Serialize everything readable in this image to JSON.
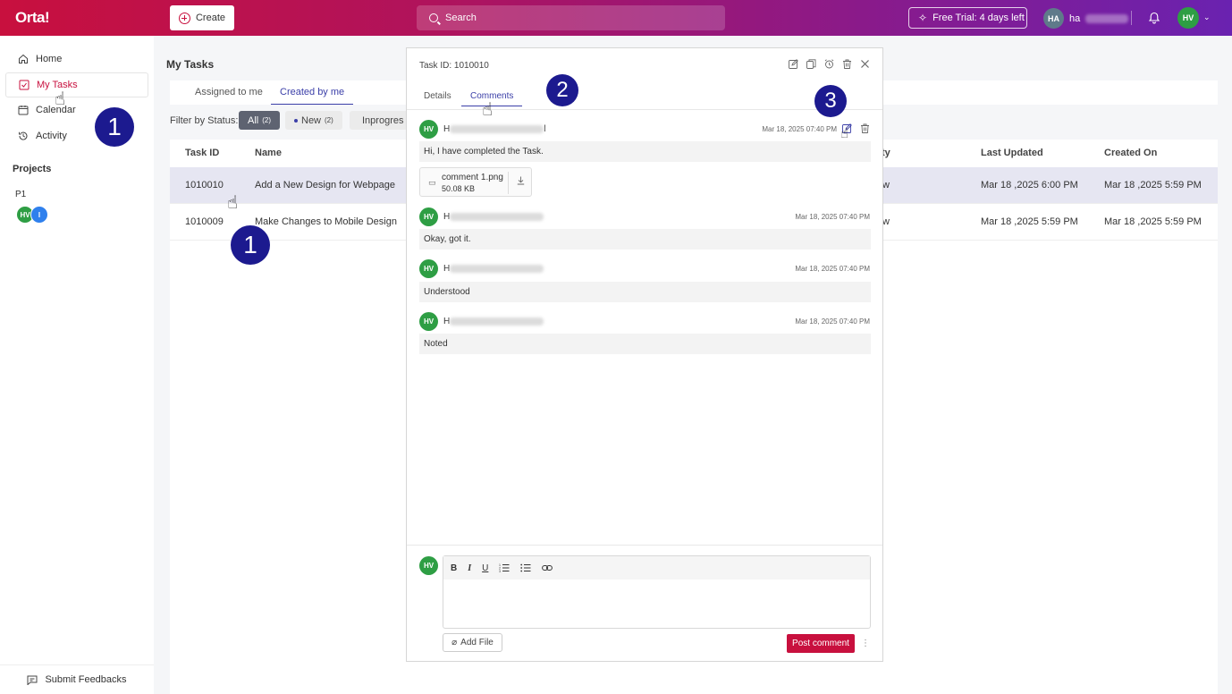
{
  "topbar": {
    "logo": "Orta!",
    "create_label": "Create",
    "search_placeholder": "Search",
    "trial_label": "Free Trial: 4 days left",
    "user_initials": "HA",
    "user_name_visible": "ha",
    "profile_initials": "HV"
  },
  "sidebar": {
    "items": [
      {
        "label": "Home",
        "icon": "home-icon"
      },
      {
        "label": "My Tasks",
        "icon": "checkbox-icon"
      },
      {
        "label": "Calendar",
        "icon": "calendar-icon"
      },
      {
        "label": "Activity",
        "icon": "history-icon"
      }
    ],
    "projects_title": "Projects",
    "project_name": "P1",
    "project_members": [
      "HV",
      "I"
    ],
    "submit_feedback": "Submit Feedbacks"
  },
  "main": {
    "title": "My Tasks",
    "tabs": [
      "Assigned to me",
      "Created by me"
    ],
    "filter_label": "Filter by Status:",
    "filters": [
      {
        "label": "All",
        "count": "(2)"
      },
      {
        "label": "New",
        "count": "(2)"
      },
      {
        "label": "Inprogres",
        "count": ""
      }
    ],
    "columns": [
      "Task ID",
      "Name",
      "ty",
      "Last Updated",
      "Created On"
    ],
    "rows": [
      {
        "id": "1010010",
        "name": "Add a New Design for Webpage",
        "status": "w",
        "updated": "Mar 18 ,2025 6:00 PM",
        "created": "Mar 18 ,2025 5:59 PM"
      },
      {
        "id": "1010009",
        "name": "Make Changes to Mobile Design",
        "status": "w",
        "updated": "Mar 18 ,2025 5:59 PM",
        "created": "Mar 18 ,2025 5:59 PM"
      }
    ]
  },
  "panel": {
    "task_id_label": "Task ID:",
    "task_id": "1010010",
    "tabs": [
      "Details",
      "Comments"
    ],
    "comments": [
      {
        "initials": "HV",
        "name_start": "H",
        "name_end": "l",
        "time": "Mar 18, 2025 07:40 PM",
        "text": "Hi, I have completed the Task."
      },
      {
        "initials": "HV",
        "name_start": "H",
        "name_end": "",
        "time": "Mar 18, 2025 07:40 PM",
        "text": "Okay, got it."
      },
      {
        "initials": "HV",
        "name_start": "H",
        "name_end": "",
        "time": "Mar 18, 2025 07:40 PM",
        "text": "Understood"
      },
      {
        "initials": "HV",
        "name_start": "H",
        "name_end": "",
        "time": "Mar 18, 2025 07:40 PM",
        "text": "Noted"
      }
    ],
    "attachment": {
      "name": "comment 1.png",
      "size": "50.08 KB"
    },
    "composer": {
      "initials": "HV",
      "toolbar": [
        "B",
        "I",
        "U"
      ],
      "add_file": "Add File",
      "post_label": "Post comment"
    }
  },
  "markers": [
    "1",
    "1",
    "2",
    "3"
  ],
  "colors": {
    "brand": "#c8103e",
    "accent": "#3b3fa8",
    "avatar_green": "#2e9e44",
    "marker": "#1c1a8f"
  }
}
